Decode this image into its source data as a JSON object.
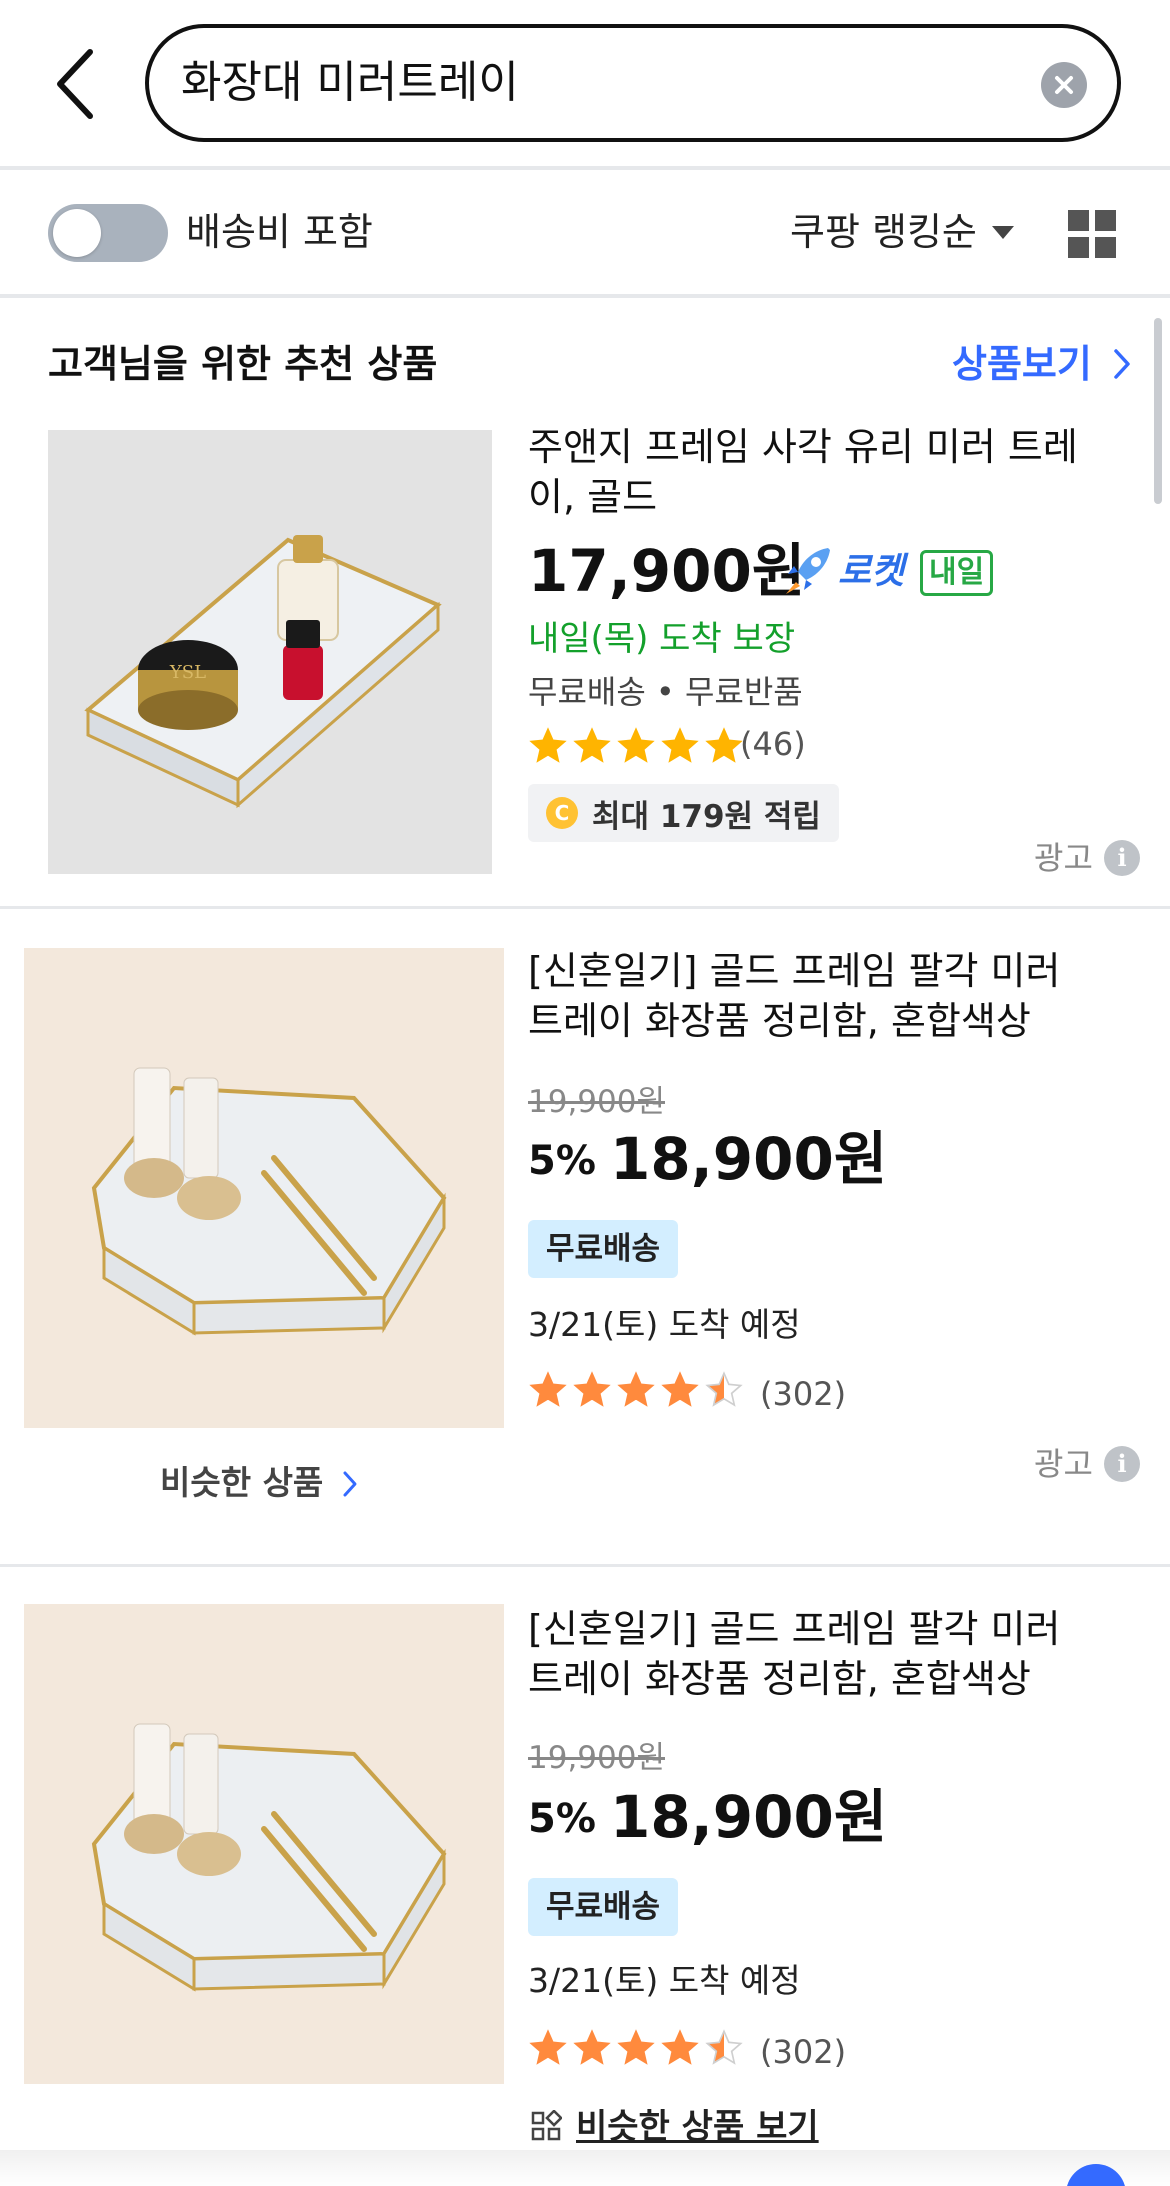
{
  "search": {
    "query": "화장대 미러트레이"
  },
  "filters": {
    "shipping_toggle_label": "배송비 포함",
    "sort_label": "쿠팡 랭킹순"
  },
  "recommendation": {
    "title": "고객님을 위한 추천 상품",
    "link_label": "상품보기",
    "product": {
      "title": "주앤지 프레임 사각 유리 미러 트레이, 골드",
      "price": "17,900원",
      "rocket_label": "로켓",
      "rocket_badge": "내일",
      "arrival": "내일(목) 도착 보장",
      "shipping": "무료배송 • 무료반품",
      "rating": 5,
      "review_count": "(46)",
      "cashback_coin": "C",
      "cashback": "최대 179원 적립",
      "ad_label": "광고"
    }
  },
  "products": [
    {
      "title": "[신혼일기] 골드 프레임 팔각 미러 트레이 화장품 정리함, 혼합색상",
      "original_price": "19,900원",
      "discount": "5%",
      "price": "18,900원",
      "shipping_badge": "무료배송",
      "arrival": "3/21(토) 도착 예정",
      "rating": 4.5,
      "review_count": "(302)",
      "similar_label": "비슷한 상품",
      "ad_label": "광고"
    },
    {
      "title": "[신혼일기] 골드 프레임 팔각 미러 트레이 화장품 정리함, 혼합색상",
      "original_price": "19,900원",
      "discount": "5%",
      "price": "18,900원",
      "shipping_badge": "무료배송",
      "arrival": "3/21(토) 도착 예정",
      "rating": 4.5,
      "review_count": "(302)",
      "similar_label": "비슷한 상품 보기"
    }
  ],
  "colors": {
    "accent_blue": "#346aff",
    "rocket_green": "#27a845",
    "star_yellow": "#ffb400",
    "star_orange": "#ff8a3d",
    "free_badge_bg": "#d3eeff"
  }
}
